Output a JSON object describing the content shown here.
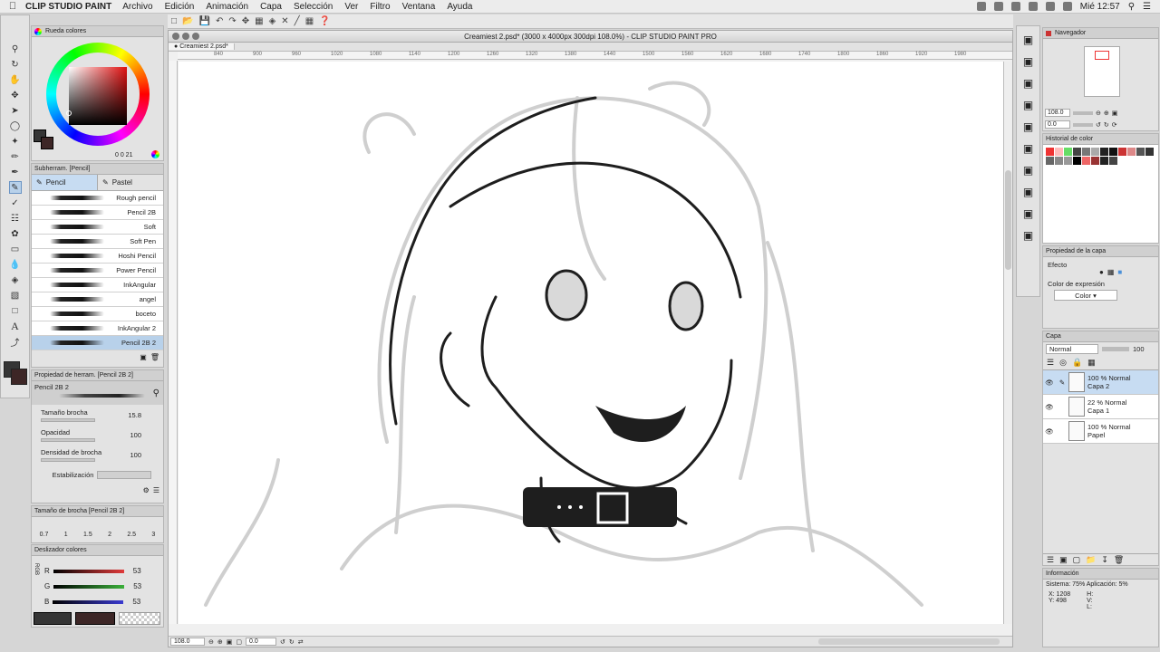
{
  "menubar": {
    "apple": "",
    "app": "CLIP STUDIO PAINT",
    "items": [
      "Archivo",
      "Edición",
      "Animación",
      "Capa",
      "Selección",
      "Ver",
      "Filtro",
      "Ventana",
      "Ayuda"
    ],
    "clock": "Mié 12:57"
  },
  "window": {
    "title": "Creamiest 2.psd* (3000 x 4000px 300dpi 108.0%) - CLIP STUDIO PAINT PRO",
    "tab": "Creamiest 2.psd*"
  },
  "ruler": {
    "ticks": [
      "840",
      "900",
      "960",
      "1020",
      "1080",
      "1140",
      "1200",
      "1260",
      "1320",
      "1380",
      "1440",
      "1500",
      "1560",
      "1620",
      "1680",
      "1740",
      "1800",
      "1860",
      "1920",
      "1980"
    ]
  },
  "color_wheel": {
    "title": "Rueda colores",
    "readout": "0  0  21"
  },
  "subtool": {
    "title": "Subherram. [Pencil]",
    "tabs": [
      "Pencil",
      "Pastel"
    ],
    "brushes": [
      "Rough pencil",
      "Pencil 2B",
      "Soft",
      "Soft Pen",
      "Hoshi Pencil",
      "Power Pencil",
      "InkAngular",
      "angel",
      "boceto",
      "InkAngular 2",
      "Pencil 2B 2"
    ]
  },
  "tool_property": {
    "title": "Propiedad de herram. [Pencil 2B 2]",
    "preview_name": "Pencil 2B 2",
    "rows": [
      {
        "label": "Tamaño brocha",
        "value": "15.8"
      },
      {
        "label": "Opacidad",
        "value": "100"
      },
      {
        "label": "Densidad de brocha",
        "value": "100"
      },
      {
        "label": "Estabilización",
        "value": ""
      }
    ]
  },
  "brush_size": {
    "title": "Tamaño de brocha [Pencil 2B 2]",
    "sizes": [
      "0.7",
      "1",
      "1.5",
      "2",
      "2.5",
      "3"
    ]
  },
  "color_slider": {
    "title": "Deslizador colores",
    "mode": "RGB",
    "channels": [
      {
        "name": "R",
        "value": "53",
        "color": "#e03a3a"
      },
      {
        "name": "G",
        "value": "53",
        "color": "#3ab03a"
      },
      {
        "name": "B",
        "value": "53",
        "color": "#3a3ad0"
      }
    ]
  },
  "navigator": {
    "title": "Navegador",
    "zoom": "108.0",
    "angle": "0.0"
  },
  "color_history": {
    "title": "Historial de color"
  },
  "layer_property": {
    "title": "Propiedad de la capa",
    "effect": "Efecto",
    "expr_label": "Color de expresión",
    "expr_value": "Color"
  },
  "layers": {
    "title": "Capa",
    "blend": "Normal",
    "opacity": "100",
    "items": [
      {
        "mode": "100 % Normal",
        "name": "Capa 2"
      },
      {
        "mode": "22 % Normal",
        "name": "Capa 1"
      },
      {
        "mode": "100 % Normal",
        "name": "Papel"
      }
    ]
  },
  "info": {
    "title": "Información",
    "system": "Sistema: 75% Aplicación:  5%",
    "x": "X: 1208",
    "y": "Y: 498",
    "h": "H:",
    "v": "V:",
    "l": "L:"
  },
  "statusbar": {
    "zoom": "108.0",
    "angle": "0.0"
  },
  "colors": {
    "main": "#353535",
    "sub": "#3d2626"
  }
}
